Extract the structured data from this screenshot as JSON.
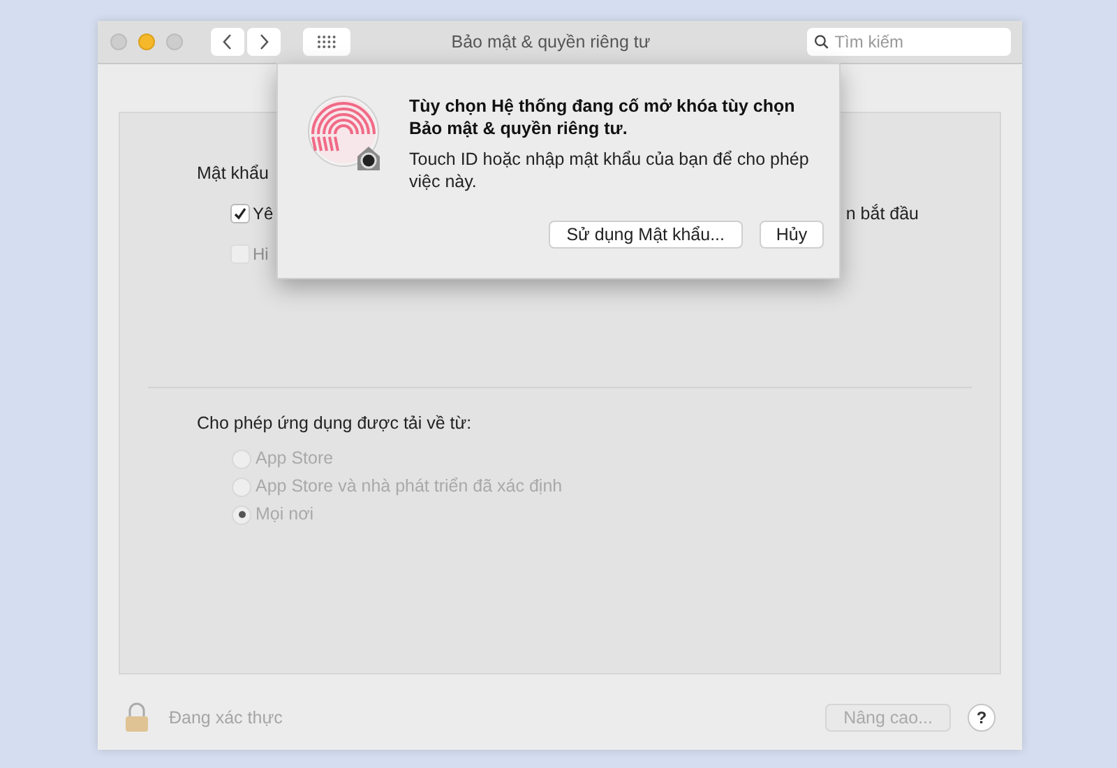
{
  "window": {
    "title": "Bảo mật & quyền riêng tư",
    "search": {
      "placeholder": "Tìm kiếm"
    }
  },
  "password_section": {
    "label": "Mật khẩu",
    "options": [
      {
        "label": "Yê",
        "checked": true,
        "disabled": false,
        "trailing": "n bắt đầu"
      },
      {
        "label": "Hi",
        "checked": false,
        "disabled": true
      }
    ]
  },
  "downloads": {
    "label": "Cho phép ứng dụng được tải về từ:",
    "disabled": true,
    "options": [
      {
        "label": "App Store",
        "selected": false
      },
      {
        "label": "App Store và nhà phát triển đã xác định",
        "selected": false
      },
      {
        "label": "Mọi nơi",
        "selected": true
      }
    ]
  },
  "footer": {
    "lock_label": "Đang xác thực",
    "advanced_button": {
      "label": "Nâng cao...",
      "disabled": true
    },
    "help": "?"
  },
  "dialog": {
    "title": "Tùy chọn Hệ thống đang cố mở khóa tùy chọn Bảo mật & quyền riêng tư.",
    "message": "Touch ID hoặc nhập mật khẩu của bạn để cho phép việc này.",
    "buttons": [
      {
        "label": "Sử dụng Mật khẩu...",
        "kind": "secondary"
      },
      {
        "label": "Hủy",
        "kind": "cancel"
      }
    ]
  }
}
